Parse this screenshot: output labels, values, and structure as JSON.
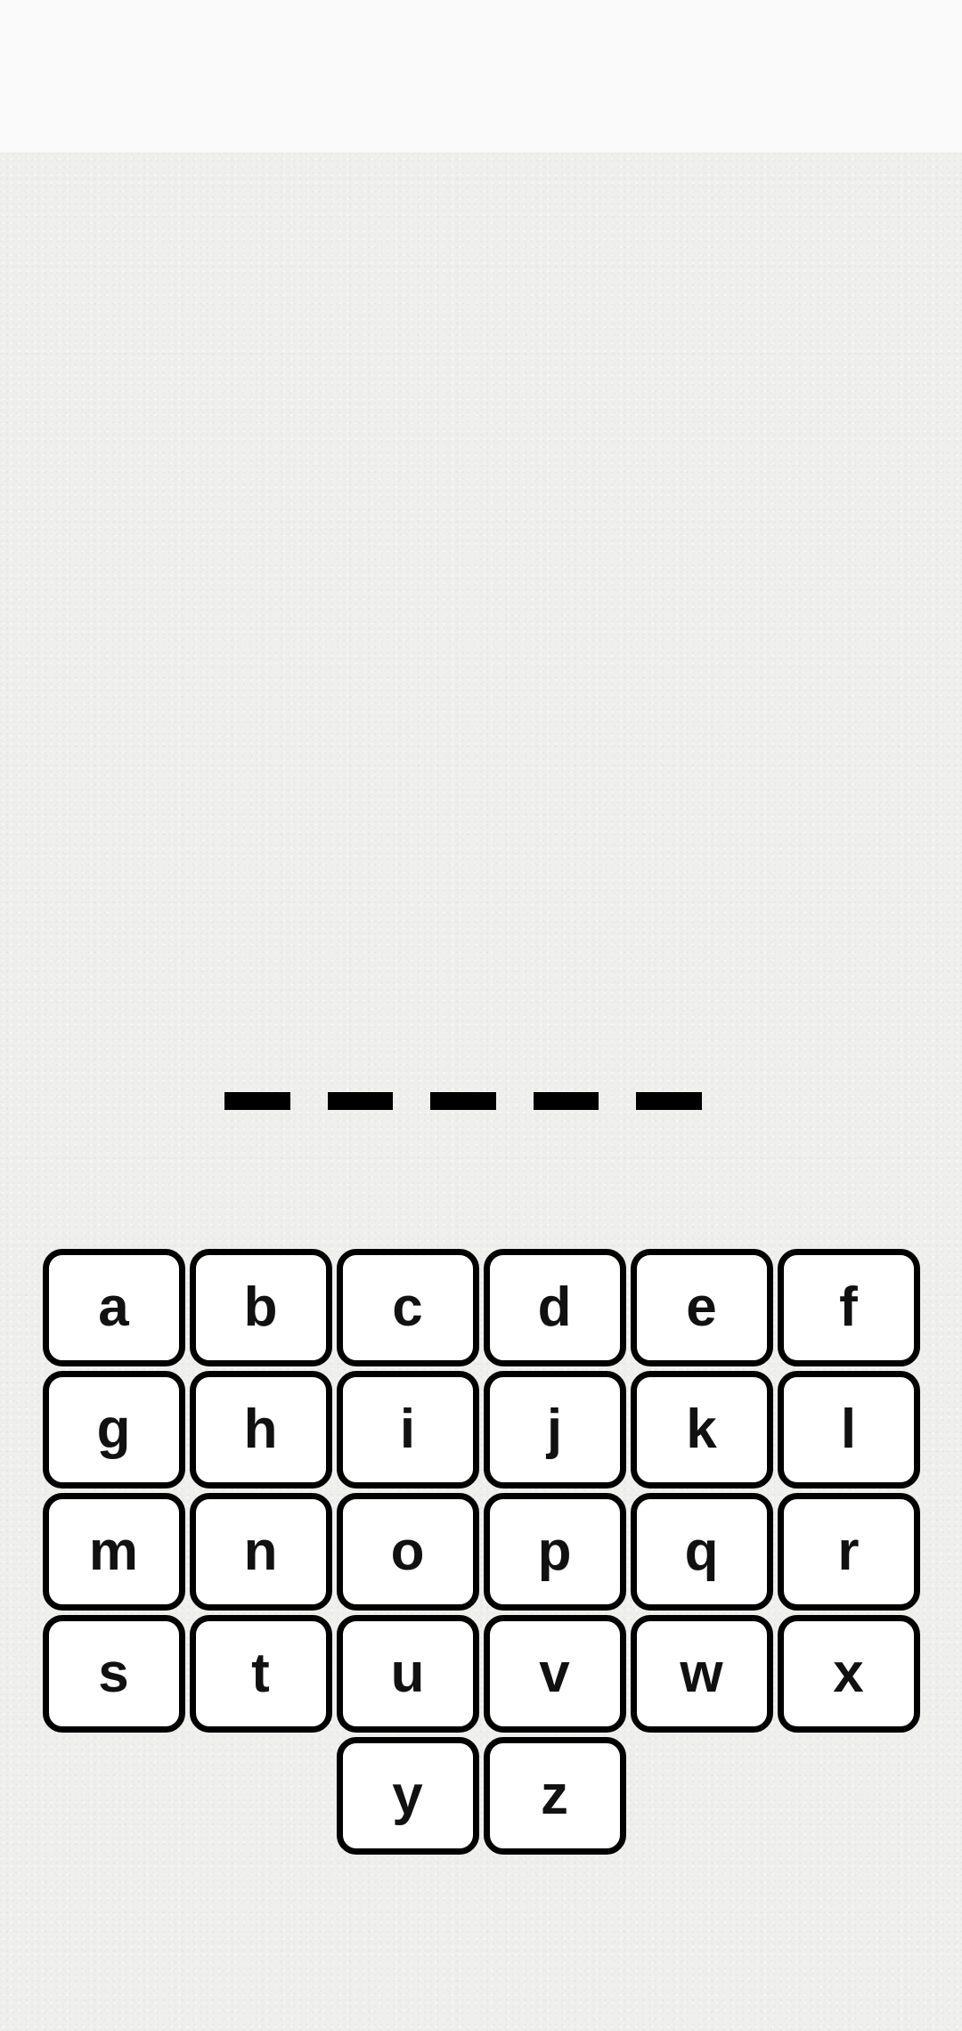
{
  "game": {
    "word_length": 5,
    "revealed": [
      "",
      "",
      "",
      "",
      ""
    ]
  },
  "keyboard": {
    "rows": [
      [
        "a",
        "b",
        "c",
        "d",
        "e",
        "f"
      ],
      [
        "g",
        "h",
        "i",
        "j",
        "k",
        "l"
      ],
      [
        "m",
        "n",
        "o",
        "p",
        "q",
        "r"
      ],
      [
        "s",
        "t",
        "u",
        "v",
        "w",
        "x"
      ],
      [
        "y",
        "z"
      ]
    ]
  },
  "colors": {
    "key_border": "#000000",
    "key_fill": "#ffffff",
    "slot": "#000000",
    "background": "#efefee"
  }
}
